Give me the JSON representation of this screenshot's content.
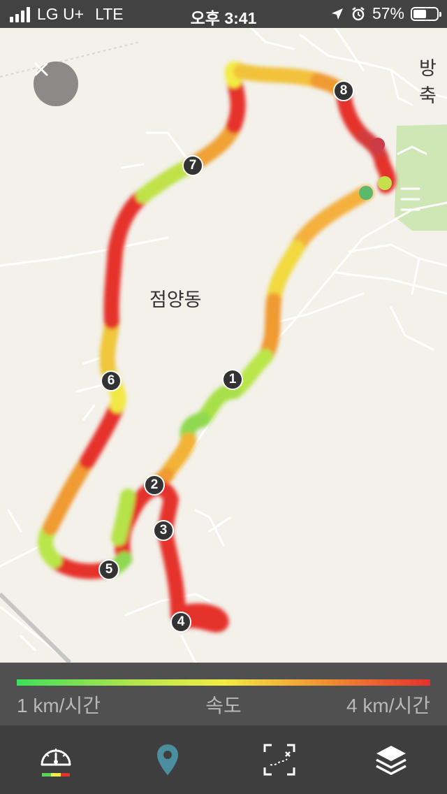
{
  "status_bar": {
    "carrier": "LG U+",
    "network": "LTE",
    "time": "오후 3:41",
    "battery": "57%",
    "battery_level": 0.57,
    "icons": [
      "signal-icon",
      "location-arrow-icon",
      "alarm-icon",
      "battery-icon"
    ]
  },
  "map": {
    "area_label": "점양동",
    "edge_label": "방축",
    "close_icon": "close-icon",
    "markers": [
      "1",
      "2",
      "3",
      "4",
      "5",
      "6",
      "7",
      "8"
    ]
  },
  "legend": {
    "title": "속도",
    "min_label": "1 km/시간",
    "max_label": "4 km/시간",
    "colors": {
      "slow": "#3ce05a",
      "mid": "#f2ec44",
      "fast": "#e5302c"
    }
  },
  "toolbar": {
    "items": [
      {
        "name": "speed",
        "icon": "speedometer-icon"
      },
      {
        "name": "location",
        "icon": "map-pin-icon",
        "color": "#4b8e9d"
      },
      {
        "name": "route-fit",
        "icon": "route-fit-icon"
      },
      {
        "name": "layers",
        "icon": "layers-icon"
      }
    ]
  }
}
